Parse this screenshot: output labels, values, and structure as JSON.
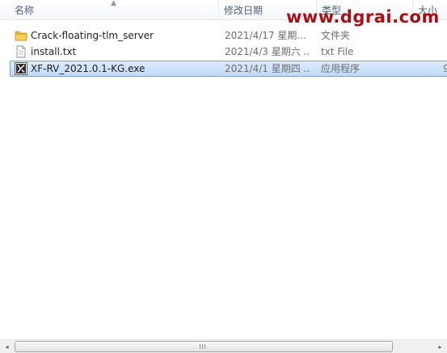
{
  "columns": {
    "name": "名称",
    "date": "修改日期",
    "type": "类型",
    "size": "大小"
  },
  "watermark": "www.dgrai.com",
  "files": [
    {
      "icon": "folder-icon",
      "name": "Crack-floating-tlm_server",
      "date": "2021/4/17 星期...",
      "type": "文件夹",
      "size": ""
    },
    {
      "icon": "text-file-icon",
      "name": "install.txt",
      "date": "2021/4/3 星期六 ...",
      "type": "txt File",
      "size": ""
    },
    {
      "icon": "exe-app-icon",
      "name": "XF-RV_2021.0.1-KG.exe",
      "date": "2021/4/1 星期四 ...",
      "type": "应用程序",
      "size": "9",
      "selected": true
    }
  ],
  "scrollbar": {
    "left_arrow": "◂",
    "right_arrow": "▸"
  },
  "colors": {
    "selection": "#cce1fb",
    "header_text": "#4c607a",
    "watermark": "#a31219"
  }
}
